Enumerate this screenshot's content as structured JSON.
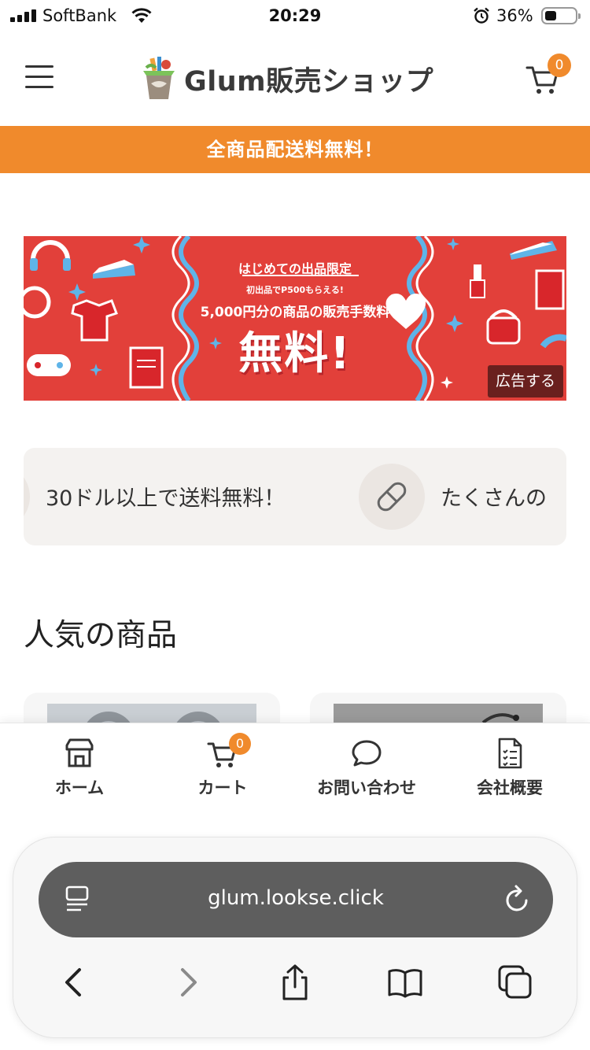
{
  "status_bar": {
    "carrier": "SoftBank",
    "time": "20:29",
    "battery_percent": "36%",
    "icons": [
      "signal-icon",
      "wifi-icon",
      "alarm-icon",
      "battery-icon"
    ]
  },
  "header": {
    "logo_text": "Glum販売ショップ",
    "cart_count": "0",
    "icons": [
      "menu-icon",
      "logo-icon",
      "cart-icon"
    ]
  },
  "promo_bar": {
    "text": "全商品配送料無料！",
    "color": "#f08a2c"
  },
  "banner": {
    "line1": "はじめての出品限定",
    "line2": "初出品でP500もらえる!",
    "line3": "5,000円分の商品の販売手数料",
    "line4": "無料!",
    "ad_label": "広告する",
    "bg_color": "#e2403a"
  },
  "info_strip": {
    "item1": "30ドル以上で送料無料！",
    "item2": "たくさんの",
    "icons": [
      "tag-icon"
    ]
  },
  "popular": {
    "title": "人気の商品"
  },
  "bottom_nav": {
    "items": [
      {
        "label": "ホーム",
        "icon": "store-icon"
      },
      {
        "label": "カート",
        "icon": "cart-icon",
        "badge": "0"
      },
      {
        "label": "お問い合わせ",
        "icon": "chat-bubble-icon"
      },
      {
        "label": "会社概要",
        "icon": "document-icon"
      }
    ]
  },
  "browser": {
    "url": "glum.lookse.click",
    "icons": [
      "reader-icon",
      "reload-icon",
      "back-icon",
      "forward-icon",
      "share-icon",
      "bookmarks-icon",
      "tabs-icon"
    ]
  },
  "colors": {
    "accent": "#f08a2c",
    "banner_red": "#e2403a"
  }
}
